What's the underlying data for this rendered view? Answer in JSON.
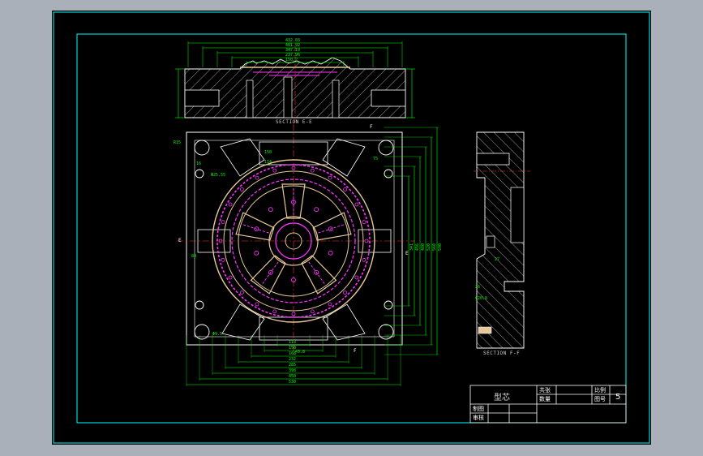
{
  "drawing": {
    "section_ee_label": "SECTION E-E",
    "section_ff_label": "SECTION F-F",
    "cut_letter_e": "E",
    "cut_letter_f": "F"
  },
  "dimensions": {
    "top_widths": [
      "432.03",
      "401.92",
      "347.19",
      "237.96",
      "150.2"
    ],
    "bottom_widths": [
      "113",
      "150",
      "168",
      "232",
      "285",
      "398",
      "450",
      "530"
    ],
    "right_heights": [
      "341",
      "456",
      "480",
      "520",
      "560",
      "590"
    ],
    "misc": [
      "R15",
      "16",
      "150",
      "114",
      "89",
      "75",
      "27",
      "26",
      "Φ20.8",
      "Φ9.5",
      "43.8",
      "Φ25.55"
    ]
  },
  "title_block": {
    "part_name": "型芯",
    "label_count": "共张",
    "label_ratio": "比例",
    "label_qty": "数量",
    "label_sheet": "图号",
    "sheet_value": "5",
    "label_drawn": "制图",
    "label_check": "审核"
  },
  "colors": {
    "background": "#000000",
    "frame": "#00ffff",
    "dimension": "#00ff00",
    "geometry": "#ffffff",
    "pink_detail": "#ff33ff",
    "tan_detail": "#e6c89a",
    "hidden": "#ff3333"
  }
}
